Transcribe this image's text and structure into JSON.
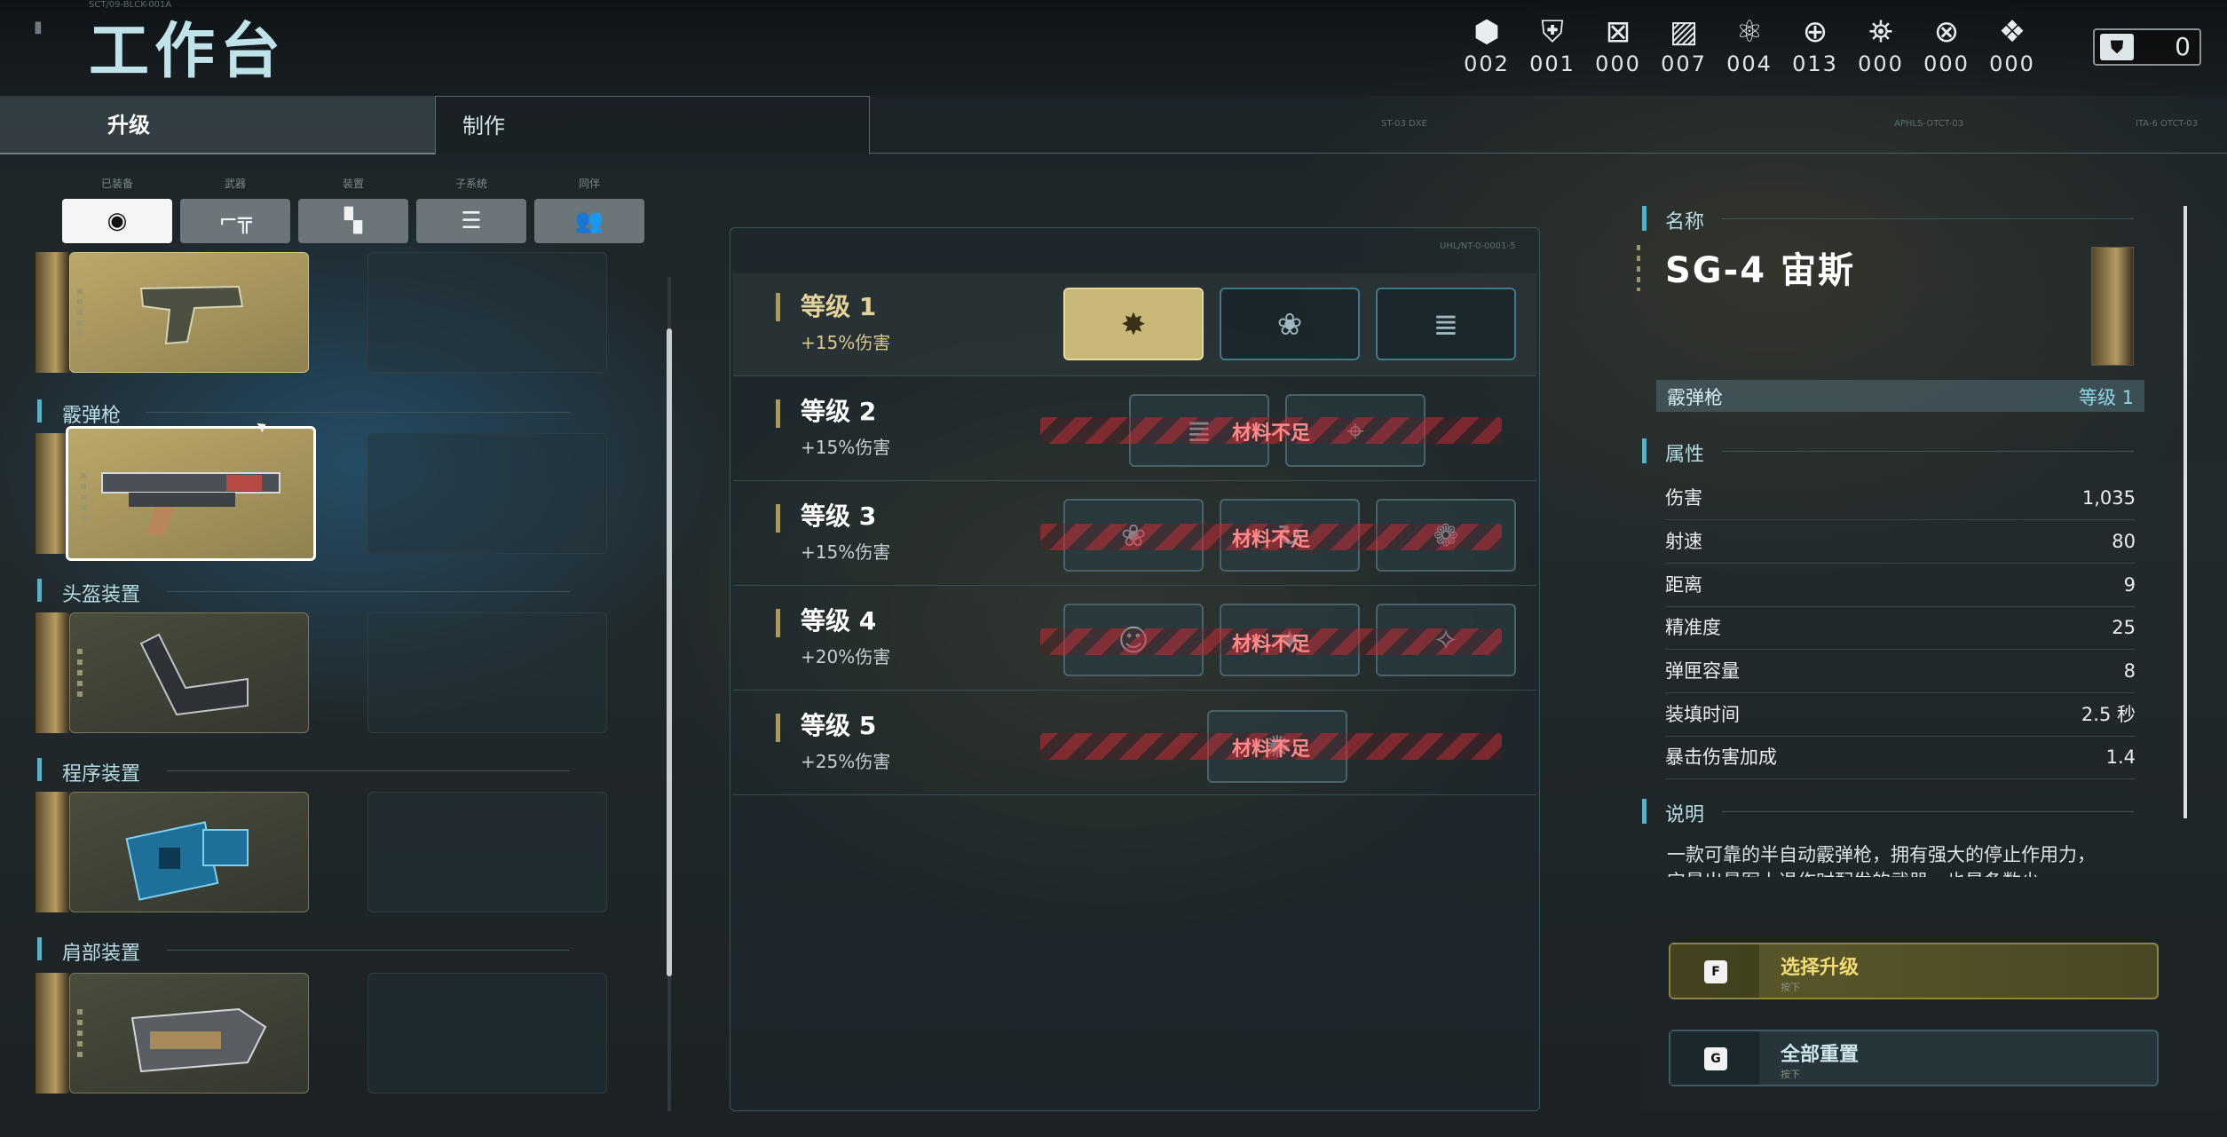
{
  "header": {
    "title": "工作台",
    "code": "SCT/09-BLCK-001A",
    "resources": [
      {
        "icon": "hex-nut-icon",
        "value": "002"
      },
      {
        "icon": "armor-icon",
        "value": "001"
      },
      {
        "icon": "frame-icon",
        "value": "000"
      },
      {
        "icon": "plates-icon",
        "value": "007"
      },
      {
        "icon": "triad-icon",
        "value": "004"
      },
      {
        "icon": "crosshair-gear-icon",
        "value": "013"
      },
      {
        "icon": "capsules-icon",
        "value": "000"
      },
      {
        "icon": "x-box-icon",
        "value": "000"
      },
      {
        "icon": "core-icon",
        "value": "000"
      }
    ],
    "medal": {
      "icon": "shield-icon",
      "value": "0"
    },
    "right_codes": [
      "ST-03 DXE",
      "APHLS-OTCT-03",
      "ITA-6 OTCT-03"
    ]
  },
  "tabs": [
    {
      "label": "升级"
    },
    {
      "label": "制作"
    }
  ],
  "categories": [
    {
      "label": "已装备",
      "icon": "helmet-icon"
    },
    {
      "label": "武器",
      "icon": "gun-icon"
    },
    {
      "label": "装置",
      "icon": "device-icon"
    },
    {
      "label": "子系统",
      "icon": "list-icon"
    },
    {
      "label": "同伴",
      "icon": "group-icon"
    }
  ],
  "equipment_sections": [
    {
      "title": "",
      "item": "pistol"
    },
    {
      "title": "霰弹枪",
      "item": "SG-4 宙斯"
    },
    {
      "title": "头盔装置",
      "item": "helmet-device"
    },
    {
      "title": "程序装置",
      "item": "program-device"
    },
    {
      "title": "肩部装置",
      "item": "shoulder-device"
    }
  ],
  "upgrades": [
    {
      "level": "等级 1",
      "bonus": "+15%伤害",
      "status": ""
    },
    {
      "level": "等级 2",
      "bonus": "+15%伤害",
      "status": "材料不足"
    },
    {
      "level": "等级 3",
      "bonus": "+15%伤害",
      "status": "材料不足"
    },
    {
      "level": "等级 4",
      "bonus": "+20%伤害",
      "status": "材料不足"
    },
    {
      "level": "等级 5",
      "bonus": "+25%伤害",
      "status": "材料不足"
    }
  ],
  "upgrade_panel_code": "UHL/NT-0-0001-5",
  "details": {
    "name_label": "名称",
    "weapon_name": "SG-4 宙斯",
    "type": "霰弹枪",
    "level": "等级 1",
    "attr_label": "属性",
    "stats": [
      {
        "key": "伤害",
        "value": "1,035"
      },
      {
        "key": "射速",
        "value": "80"
      },
      {
        "key": "距离",
        "value": "9"
      },
      {
        "key": "精准度",
        "value": "25"
      },
      {
        "key": "弹匣容量",
        "value": "8"
      },
      {
        "key": "装填时间",
        "value": "2.5 秒"
      },
      {
        "key": "暴击伤害加成",
        "value": "1.4"
      }
    ],
    "desc_label": "说明",
    "description": "一款可靠的半自动霰弹枪，拥有强大的停止作用力，它最出最军上退作时配发的武器，也是条数少"
  },
  "actions": [
    {
      "key": "F",
      "label": "选择升级",
      "sub": "按下"
    },
    {
      "key": "G",
      "label": "全部重置",
      "sub": "按下"
    }
  ],
  "colors": {
    "accent": "#5bb0c6",
    "gold": "#c8b878",
    "warning": "#ff8a8a"
  }
}
